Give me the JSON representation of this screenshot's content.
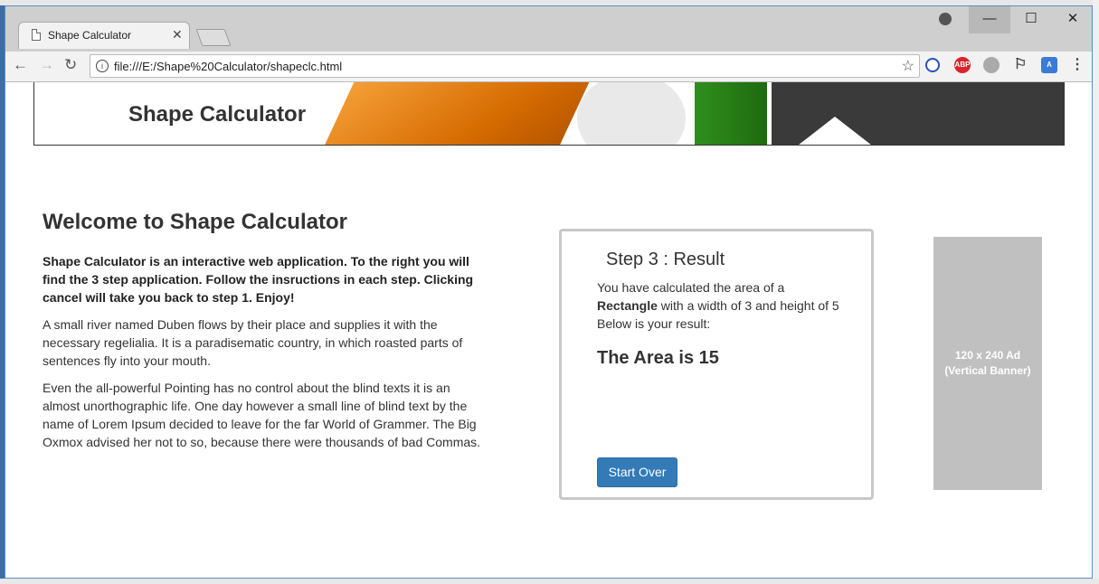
{
  "browser": {
    "tab_title": "Shape Calculator",
    "tab_close": "✕",
    "url": "file:///E:/Shape%20Calculator/shapeclc.html",
    "buttons": {
      "back": "←",
      "forward": "→",
      "reload": "↻",
      "bookmark": "☆",
      "minimize": "—",
      "maximize": "☐",
      "close": "✕"
    },
    "extensions": [
      "no-icon",
      "ABP",
      "globe-icon",
      "bookmark-icon",
      "translate-icon"
    ],
    "menu": "⋮"
  },
  "banner": {
    "title": "Shape Calculator"
  },
  "intro": {
    "heading": "Welcome to Shape Calculator",
    "lead": "Shape Calculator is an interactive web application. To the right you will find the 3 step application. Follow the insructions in each step. Clicking cancel will take you back to step 1. Enjoy!",
    "para1": "A small river named Duben flows by their place and supplies it with the necessary regelialia. It is a paradisematic country, in which roasted parts of sentences fly into your mouth.",
    "para2": "Even the all-powerful Pointing has no control about the blind texts it is an almost unorthographic life. One day however a small line of blind text by the name of Lorem Ipsum decided to leave for the far World of Grammer. The Big Oxmox advised her not to so, because there were thousands of bad Commas."
  },
  "result": {
    "heading": "Step 3 : Result",
    "msg_before": "You have calculated the area of a ",
    "shape": "Rectangle",
    "msg_after": " with a width of 3 and height of 5 Below is your result:",
    "area": "The Area is 15",
    "button": "Start Over"
  },
  "ad": {
    "line1": "120 x 240 Ad",
    "line2": "(Vertical Banner)"
  },
  "colors": {
    "primary_button": "#337ab7",
    "ad_bg": "#c0c0c0"
  }
}
